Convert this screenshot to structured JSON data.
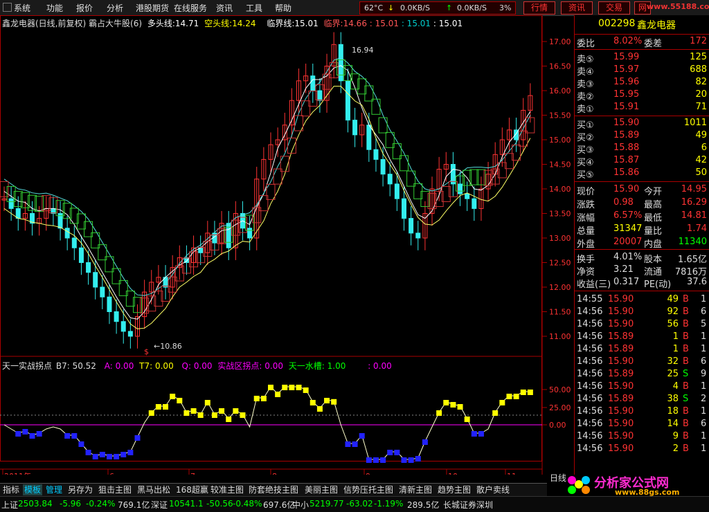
{
  "menu": {
    "items": [
      "系统",
      "功能",
      "报价",
      "分析",
      "港股期货",
      "在线服务",
      "资讯",
      "工具",
      "帮助"
    ],
    "temp": "62°C",
    "down_speed": "0.0KB/S",
    "up_speed": "0.0KB/S",
    "cpu": "3%",
    "buttons": [
      "行情",
      "资讯",
      "交易",
      "网"
    ],
    "site": "www.55188.com"
  },
  "chart": {
    "stock_name": "鑫龙电器(日线,前复权)",
    "indicator_name": "霸占大牛股(6)",
    "duotou_label": "多头线:",
    "duotou_value": "14.71",
    "kongtou_label": "空头线:",
    "kongtou_value": "14.24",
    "linjie_label": "临界线:",
    "linjie_value": "15.01",
    "linjie2_label": "临界:",
    "linjie2_value": "14.66",
    "v1": ": 15.01",
    "v2": ": 15.01",
    "v3": ": 15.01",
    "y_ticks": [
      "17.00",
      "16.50",
      "16.00",
      "15.50",
      "15.00",
      "14.50",
      "14.00",
      "13.50",
      "13.00",
      "12.50",
      "12.00",
      "11.50",
      "11.00"
    ],
    "high_label": "16.94",
    "low_label": "←10.86",
    "sub_name": "天一实战拐点",
    "sub_b7": "B7: 50.52",
    "sub_a": "A: 0.00",
    "sub_t7": "T7: 0.00",
    "sub_q": "Q: 0.00",
    "sub_sz": "实战区拐点: 0.00",
    "sub_ty": "天一水槽: 1.00",
    "sub_last": ": 0.00",
    "sub_ticks": [
      "50.00",
      "25.00",
      "0.00"
    ],
    "x_labels": [
      "2011年",
      "6",
      "7",
      "8",
      "9",
      "10",
      "11"
    ],
    "period": "日线",
    "dollar": "$"
  },
  "quote": {
    "code": "002298",
    "name": "鑫龙电器",
    "wb_label": "委比",
    "wb_value": "8.02%",
    "wc_label": "委差",
    "wc_value": "172",
    "sells": [
      {
        "label": "卖⑤",
        "price": "15.99",
        "vol": "125"
      },
      {
        "label": "卖④",
        "price": "15.97",
        "vol": "688"
      },
      {
        "label": "卖③",
        "price": "15.96",
        "vol": "82"
      },
      {
        "label": "卖②",
        "price": "15.95",
        "vol": "20"
      },
      {
        "label": "卖①",
        "price": "15.91",
        "vol": "71"
      }
    ],
    "buys": [
      {
        "label": "买①",
        "price": "15.90",
        "vol": "1011"
      },
      {
        "label": "买②",
        "price": "15.89",
        "vol": "49"
      },
      {
        "label": "买③",
        "price": "15.88",
        "vol": "6"
      },
      {
        "label": "买④",
        "price": "15.87",
        "vol": "42"
      },
      {
        "label": "买⑤",
        "price": "15.86",
        "vol": "50"
      }
    ],
    "stats": [
      {
        "l1": "现价",
        "v1": "15.90",
        "l2": "今开",
        "v2": "14.95"
      },
      {
        "l1": "涨跌",
        "v1": "0.98",
        "l2": "最高",
        "v2": "16.29"
      },
      {
        "l1": "涨幅",
        "v1": "6.57%",
        "l2": "最低",
        "v2": "14.81"
      },
      {
        "l1": "总量",
        "v1": "31347",
        "l2": "量比",
        "v2": "1.74"
      },
      {
        "l1": "外盘",
        "v1": "20007",
        "l2": "内盘",
        "v2": "11340"
      }
    ],
    "fin": [
      {
        "l1": "换手",
        "v1": "4.01%",
        "l2": "股本",
        "v2": "1.65亿"
      },
      {
        "l1": "净资",
        "v1": "3.21",
        "l2": "流通",
        "v2": "7816万"
      },
      {
        "l1": "收益(三)",
        "v1": "0.317",
        "l2": "PE(动)",
        "v2": "37.6"
      }
    ],
    "ticks": [
      {
        "t": "14:55",
        "p": "15.90",
        "v": "49",
        "bs": "B",
        "n": "1"
      },
      {
        "t": "14:56",
        "p": "15.90",
        "v": "92",
        "bs": "B",
        "n": "6"
      },
      {
        "t": "14:56",
        "p": "15.90",
        "v": "56",
        "bs": "B",
        "n": "5"
      },
      {
        "t": "14:56",
        "p": "15.89",
        "v": "1",
        "bs": "B",
        "n": "1"
      },
      {
        "t": "14:56",
        "p": "15.89",
        "v": "1",
        "bs": "B",
        "n": "1"
      },
      {
        "t": "14:56",
        "p": "15.90",
        "v": "32",
        "bs": "B",
        "n": "6"
      },
      {
        "t": "14:56",
        "p": "15.89",
        "v": "25",
        "bs": "S",
        "n": "9"
      },
      {
        "t": "14:56",
        "p": "15.90",
        "v": "4",
        "bs": "B",
        "n": "1"
      },
      {
        "t": "14:56",
        "p": "15.89",
        "v": "38",
        "bs": "S",
        "n": "2"
      },
      {
        "t": "14:56",
        "p": "15.90",
        "v": "18",
        "bs": "B",
        "n": "1"
      },
      {
        "t": "14:56",
        "p": "15.90",
        "v": "14",
        "bs": "B",
        "n": "6"
      },
      {
        "t": "14:56",
        "p": "15.90",
        "v": "9",
        "bs": "B",
        "n": "1"
      },
      {
        "t": "14:56",
        "p": "15.90",
        "v": "2",
        "bs": "B",
        "n": "1"
      }
    ]
  },
  "tabs": [
    "指标",
    "模板",
    "管理",
    "另存为",
    "狙击主图",
    "黑马出松",
    "168超赢",
    "较准主图",
    "防套绝技主图",
    "美丽主图",
    "信势压托主图",
    "清新主图",
    "趋势主图",
    "散户卖线"
  ],
  "index_bar": {
    "sh_label": "上证",
    "sh_value": "2503.84",
    "sh_chg": "-5.96",
    "sh_pct": "-0.24%",
    "sh_amt": "769.1亿",
    "sz_label": "深证",
    "sz_value": "10541.1",
    "sz_chg": "-50.56",
    "sz_pct": "-0.48%",
    "sz_amt": "697.6亿",
    "zx_label": "中小",
    "zx_value": "5219.77",
    "zx_chg": "-63.02",
    "zx_pct": "-1.19%",
    "zx_amt": "289.5亿",
    "broker": "长城证券深圳"
  },
  "brand": {
    "text": "分析家公式网",
    "url": "www.88gs.com"
  },
  "colors": {
    "up": "#ff3b3b",
    "down": "#3be0e0",
    "yellow": "#ffff00",
    "green": "#00ff00",
    "panel_border": "#aa0000"
  }
}
